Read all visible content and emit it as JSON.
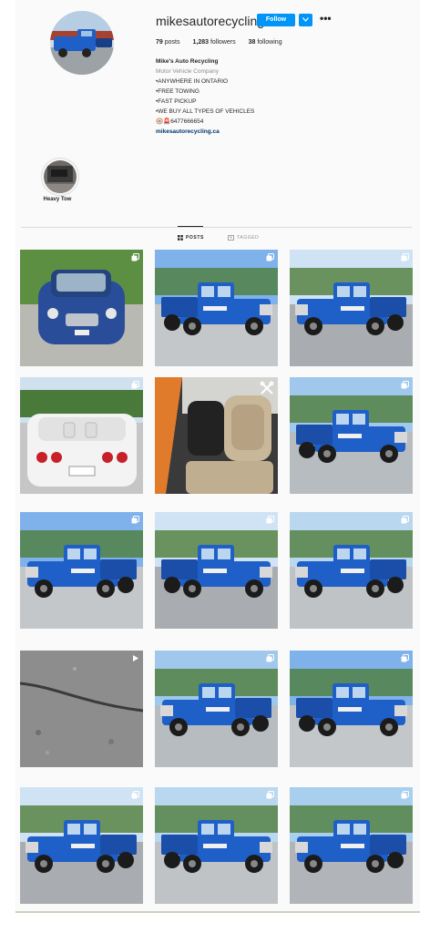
{
  "profile": {
    "username": "mikesautorecycling",
    "follow_label": "Follow",
    "more_label": "•••",
    "posts_count": "79",
    "posts_label": "posts",
    "followers_count": "1,283",
    "followers_label": "followers",
    "following_count": "38",
    "following_label": "following"
  },
  "bio": {
    "name": "Mike's Auto Recycling",
    "category": "Motor Vehicle Company",
    "lines": [
      "•ANYWHERE IN ONTARIO",
      "•FREE TOWING",
      "•FAST PICKUP",
      "•WE BUY ALL TYPES OF VEHICLES"
    ],
    "phone_emojis": "🛞🚨",
    "phone": "6477666654",
    "website": "mikesautorecycling.ca"
  },
  "highlights": [
    {
      "label": "Heavy Tow"
    }
  ],
  "tabs": {
    "posts": "POSTS",
    "tagged": "TAGGED"
  },
  "colors": {
    "accent": "#0095f6",
    "truck_blue": "#1f5fc8",
    "link": "#00376b"
  },
  "posts": [
    {
      "subject": "blue-mini-cooper",
      "icon": "multi-icon"
    },
    {
      "subject": "blue-tow-truck",
      "icon": "multi-icon"
    },
    {
      "subject": "blue-tow-truck",
      "icon": "multi-icon"
    },
    {
      "subject": "white-corvette",
      "icon": "multi-icon"
    },
    {
      "subject": "car-interior-seats",
      "icon": "tools-icon"
    },
    {
      "subject": "blue-tow-truck",
      "icon": "multi-icon"
    },
    {
      "subject": "blue-tow-truck",
      "icon": "multi-icon"
    },
    {
      "subject": "blue-tow-truck",
      "icon": "multi-icon"
    },
    {
      "subject": "blue-tow-truck",
      "icon": "multi-icon"
    },
    {
      "subject": "asphalt-road",
      "icon": "video-icon"
    },
    {
      "subject": "blue-tow-truck",
      "icon": "multi-icon"
    },
    {
      "subject": "blue-tow-truck",
      "icon": "multi-icon"
    },
    {
      "subject": "blue-tow-truck",
      "icon": "multi-icon"
    },
    {
      "subject": "blue-tow-truck",
      "icon": "multi-icon"
    },
    {
      "subject": "blue-tow-truck",
      "icon": "multi-icon"
    }
  ]
}
